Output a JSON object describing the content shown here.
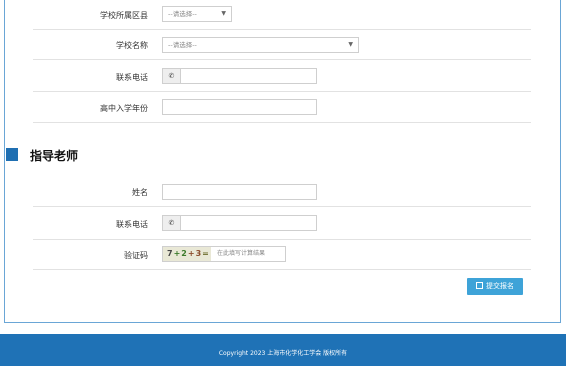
{
  "school_info": {
    "district_label": "学校所属区县",
    "district_select": "--请选择--",
    "school_label": "学校名称",
    "school_select": "--请选择--",
    "phone_label": "联系电话",
    "phone_icon": "phone-icon",
    "phone_value": "",
    "year_label": "高中入学年份",
    "year_value": ""
  },
  "teacher_section": {
    "title": "指导老师",
    "accent_color": "#1f6fb2",
    "name_label": "姓名",
    "name_value": "",
    "phone_label": "联系电话",
    "phone_value": "",
    "captcha_label": "验证码",
    "captcha_image_text": {
      "a": "7",
      "b": "+2",
      "c": "+3",
      "d": "="
    },
    "captcha_placeholder": "在此填写计算结果"
  },
  "actions": {
    "submit_label": "提交报名",
    "submit_color": "#3ea3d8"
  },
  "footer": {
    "copyright": "Copyright 2023 上海市化学化工学会 版权所有",
    "background": "#1f72b6"
  }
}
